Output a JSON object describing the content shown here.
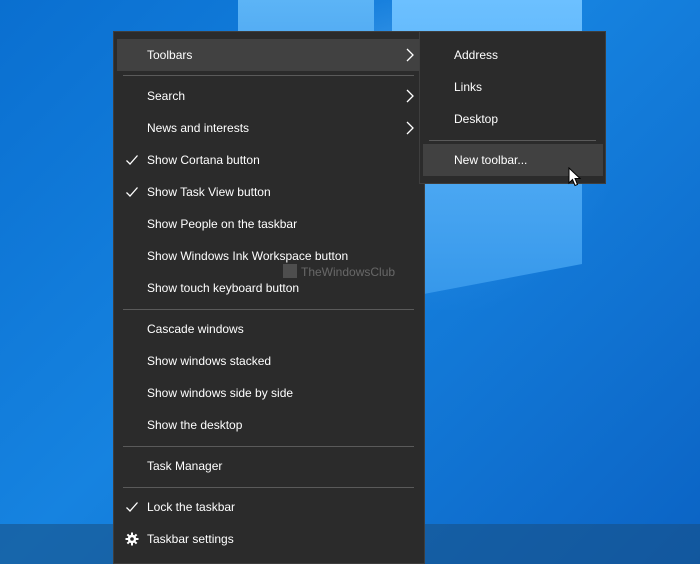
{
  "colors": {
    "menu_bg": "#2b2b2b",
    "menu_highlight": "#414141",
    "separator": "#5a5a5a",
    "text": "#ffffff",
    "desktop_blue": "#0a6fd0"
  },
  "context_menu": {
    "items": [
      {
        "label": "Toolbars",
        "has_submenu": true,
        "highlighted": true
      },
      {
        "label": "Search",
        "has_submenu": true
      },
      {
        "label": "News and interests",
        "has_submenu": true
      },
      {
        "label": "Show Cortana button",
        "checked": true
      },
      {
        "label": "Show Task View button",
        "checked": true
      },
      {
        "label": "Show People on the taskbar"
      },
      {
        "label": "Show Windows Ink Workspace button"
      },
      {
        "label": "Show touch keyboard button"
      },
      {
        "label": "Cascade windows"
      },
      {
        "label": "Show windows stacked"
      },
      {
        "label": "Show windows side by side"
      },
      {
        "label": "Show the desktop"
      },
      {
        "label": "Task Manager"
      },
      {
        "label": "Lock the taskbar",
        "checked": true
      },
      {
        "label": "Taskbar settings",
        "icon": "gear-icon"
      }
    ]
  },
  "toolbars_submenu": {
    "items": [
      {
        "label": "Address"
      },
      {
        "label": "Links"
      },
      {
        "label": "Desktop"
      },
      {
        "label": "New toolbar...",
        "highlighted": true
      }
    ]
  },
  "watermark": "TheWindowsClub"
}
